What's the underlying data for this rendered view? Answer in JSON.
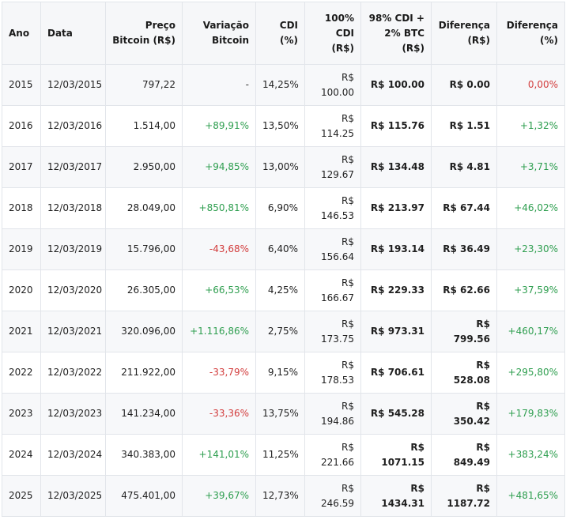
{
  "table": {
    "headers": {
      "ano": "Ano",
      "data": "Data",
      "preco": "Preço Bitcoin (R$)",
      "variacao": "Variação Bitcoin",
      "cdi": "CDI (%)",
      "cdi100": "100% CDI (R$)",
      "mix": "98% CDI + 2% BTC (R$)",
      "diferenca": "Diferença (R$)",
      "diferenca_pct": "Diferença (%)"
    },
    "rows": [
      {
        "ano": "2015",
        "data": "12/03/2015",
        "preco": "797,22",
        "variacao": "-",
        "cdi": "14,25%",
        "cdi100": "R$ 100.00",
        "mix": "R$ 100.00",
        "diferenca": "R$ 0.00",
        "diferenca_pct": "0,00%"
      },
      {
        "ano": "2016",
        "data": "12/03/2016",
        "preco": "1.514,00",
        "variacao": "+89,91%",
        "cdi": "13,50%",
        "cdi100": "R$ 114.25",
        "mix": "R$ 115.76",
        "diferenca": "R$ 1.51",
        "diferenca_pct": "+1,32%"
      },
      {
        "ano": "2017",
        "data": "12/03/2017",
        "preco": "2.950,00",
        "variacao": "+94,85%",
        "cdi": "13,00%",
        "cdi100": "R$ 129.67",
        "mix": "R$ 134.48",
        "diferenca": "R$ 4.81",
        "diferenca_pct": "+3,71%"
      },
      {
        "ano": "2018",
        "data": "12/03/2018",
        "preco": "28.049,00",
        "variacao": "+850,81%",
        "cdi": "6,90%",
        "cdi100": "R$ 146.53",
        "mix": "R$ 213.97",
        "diferenca": "R$ 67.44",
        "diferenca_pct": "+46,02%"
      },
      {
        "ano": "2019",
        "data": "12/03/2019",
        "preco": "15.796,00",
        "variacao": "-43,68%",
        "cdi": "6,40%",
        "cdi100": "R$ 156.64",
        "mix": "R$ 193.14",
        "diferenca": "R$ 36.49",
        "diferenca_pct": "+23,30%"
      },
      {
        "ano": "2020",
        "data": "12/03/2020",
        "preco": "26.305,00",
        "variacao": "+66,53%",
        "cdi": "4,25%",
        "cdi100": "R$ 166.67",
        "mix": "R$ 229.33",
        "diferenca": "R$ 62.66",
        "diferenca_pct": "+37,59%"
      },
      {
        "ano": "2021",
        "data": "12/03/2021",
        "preco": "320.096,00",
        "variacao": "+1.116,86%",
        "cdi": "2,75%",
        "cdi100": "R$ 173.75",
        "mix": "R$ 973.31",
        "diferenca": "R$ 799.56",
        "diferenca_pct": "+460,17%"
      },
      {
        "ano": "2022",
        "data": "12/03/2022",
        "preco": "211.922,00",
        "variacao": "-33,79%",
        "cdi": "9,15%",
        "cdi100": "R$ 178.53",
        "mix": "R$ 706.61",
        "diferenca": "R$ 528.08",
        "diferenca_pct": "+295,80%"
      },
      {
        "ano": "2023",
        "data": "12/03/2023",
        "preco": "141.234,00",
        "variacao": "-33,36%",
        "cdi": "13,75%",
        "cdi100": "R$ 194.86",
        "mix": "R$ 545.28",
        "diferenca": "R$ 350.42",
        "diferenca_pct": "+179,83%"
      },
      {
        "ano": "2024",
        "data": "12/03/2024",
        "preco": "340.383,00",
        "variacao": "+141,01%",
        "cdi": "11,25%",
        "cdi100": "R$ 221.66",
        "mix": "R$ 1071.15",
        "diferenca": "R$ 849.49",
        "diferenca_pct": "+383,24%"
      },
      {
        "ano": "2025",
        "data": "12/03/2025",
        "preco": "475.401,00",
        "variacao": "+39,67%",
        "cdi": "12,73%",
        "cdi100": "R$ 246.59",
        "mix": "R$ 1434.31",
        "diferenca": "R$ 1187.72",
        "diferenca_pct": "+481,65%"
      }
    ]
  },
  "colors": {
    "positive": "#2e9e4f",
    "negative": "#d23b3b",
    "header_bg": "#f6f7f9",
    "border": "#e2e5ea"
  }
}
